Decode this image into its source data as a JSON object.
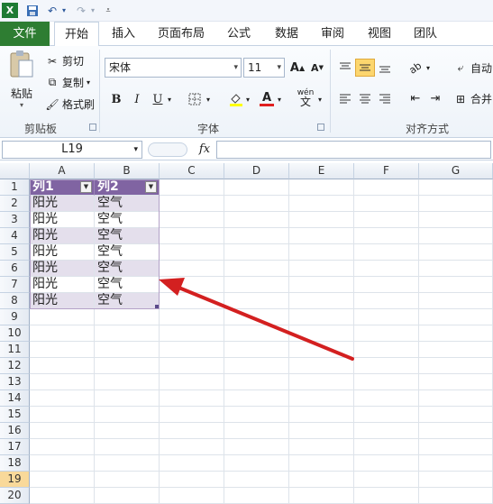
{
  "qat": {
    "app_icon": "excel-logo",
    "save_icon": "save-icon",
    "undo_icon": "undo-icon",
    "redo_icon": "redo-icon"
  },
  "tabs": [
    "文件",
    "开始",
    "插入",
    "页面布局",
    "公式",
    "数据",
    "审阅",
    "视图",
    "团队"
  ],
  "ribbon": {
    "clipboard": {
      "paste": "粘贴",
      "cut": "剪切",
      "copy": "复制",
      "format_painter": "格式刷",
      "label": "剪贴板"
    },
    "font": {
      "font_name": "宋体",
      "font_size": "11",
      "bold": "B",
      "italic": "I",
      "underline": "U",
      "label": "字体"
    },
    "alignment": {
      "wrap": "自动",
      "merge": "合并",
      "label": "对齐方式"
    }
  },
  "formula_bar": {
    "name_box": "L19",
    "fx": "fx",
    "value": ""
  },
  "grid": {
    "columns": [
      "A",
      "B",
      "C",
      "D",
      "E",
      "F",
      "G"
    ],
    "rows": [
      "1",
      "2",
      "3",
      "4",
      "5",
      "6",
      "7",
      "8",
      "9",
      "10",
      "11",
      "12",
      "13",
      "14",
      "15",
      "16",
      "17",
      "18",
      "19",
      "20"
    ],
    "selected_row": "19",
    "table_header": [
      "列1",
      "列2"
    ],
    "table_rows": [
      [
        "阳光",
        "空气"
      ],
      [
        "阳光",
        "空气"
      ],
      [
        "阳光",
        "空气"
      ],
      [
        "阳光",
        "空气"
      ],
      [
        "阳光",
        "空气"
      ],
      [
        "阳光",
        "空气"
      ],
      [
        "阳光",
        "空气"
      ]
    ]
  },
  "colors": {
    "file_tab": "#2e7d32",
    "table_header": "#8064a2",
    "table_band": "#e4dfec",
    "arrow": "#d32020",
    "selected_row_header": "#f9d99a"
  }
}
